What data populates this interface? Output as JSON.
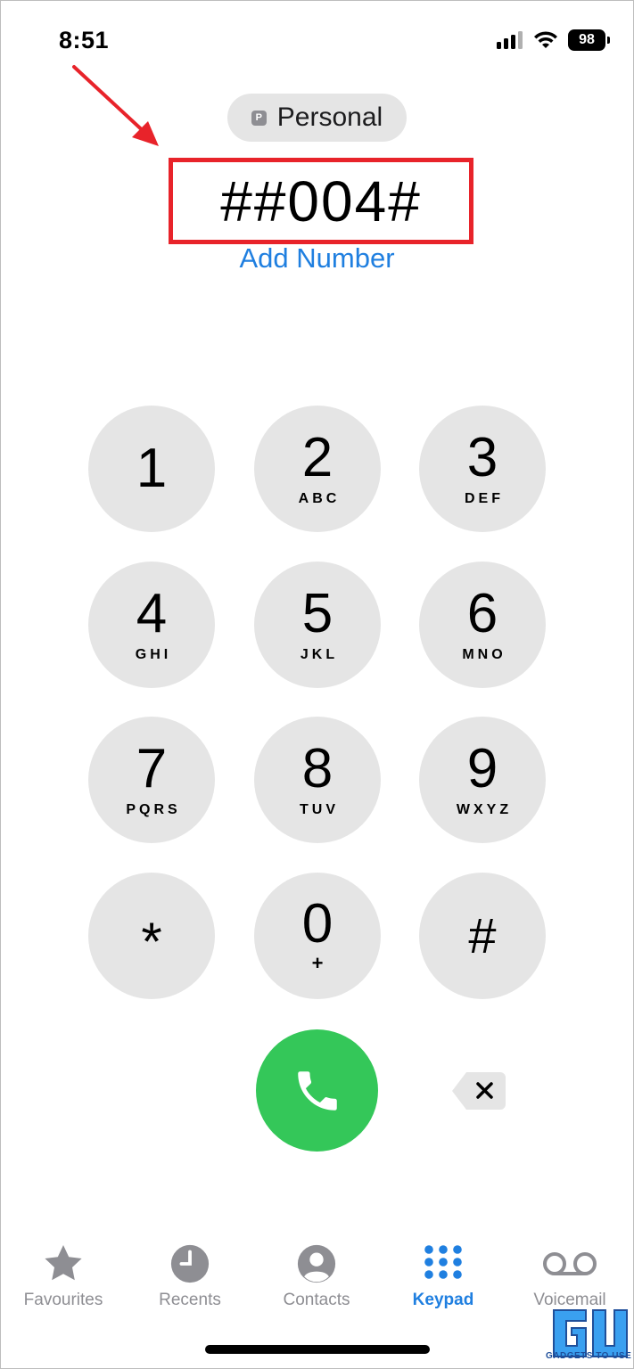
{
  "status_bar": {
    "time": "8:51",
    "battery": "98"
  },
  "sim": {
    "badge": "P",
    "label": "Personal"
  },
  "dialer": {
    "number": "##004#",
    "add_number": "Add Number"
  },
  "keypad": [
    {
      "digit": "1",
      "letters": ""
    },
    {
      "digit": "2",
      "letters": "ABC"
    },
    {
      "digit": "3",
      "letters": "DEF"
    },
    {
      "digit": "4",
      "letters": "GHI"
    },
    {
      "digit": "5",
      "letters": "JKL"
    },
    {
      "digit": "6",
      "letters": "MNO"
    },
    {
      "digit": "7",
      "letters": "PQRS"
    },
    {
      "digit": "8",
      "letters": "TUV"
    },
    {
      "digit": "9",
      "letters": "WXYZ"
    },
    {
      "digit": "*",
      "letters": ""
    },
    {
      "digit": "0",
      "letters": "+"
    },
    {
      "digit": "#",
      "letters": ""
    }
  ],
  "tabs": [
    {
      "label": "Favourites",
      "icon": "star-icon"
    },
    {
      "label": "Recents",
      "icon": "clock-icon"
    },
    {
      "label": "Contacts",
      "icon": "person-icon"
    },
    {
      "label": "Keypad",
      "icon": "keypad-icon",
      "active": true
    },
    {
      "label": "Voicemail",
      "icon": "voicemail-icon"
    }
  ],
  "watermark": {
    "caption": "GADGETS TO USE"
  },
  "colors": {
    "accent": "#1f7fe0",
    "call_green": "#34c759",
    "key_gray": "#e5e5e5",
    "highlight_red": "#e8232a"
  }
}
